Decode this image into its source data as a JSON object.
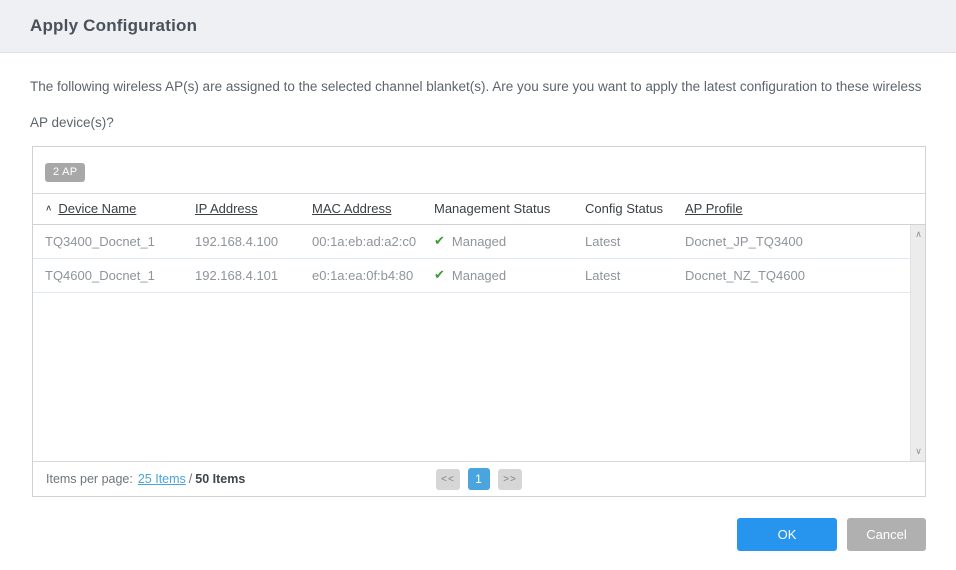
{
  "dialog": {
    "title": "Apply Configuration",
    "description": "The following wireless AP(s) are assigned to the selected channel blanket(s). Are you sure you want to apply the latest configuration to these wireless AP device(s)?"
  },
  "table": {
    "count_badge": "2 AP",
    "columns": [
      {
        "label": "Device Name",
        "sortable": true,
        "sorted": "asc"
      },
      {
        "label": "IP Address",
        "sortable": true
      },
      {
        "label": "MAC Address",
        "sortable": true
      },
      {
        "label": "Management Status",
        "sortable": false
      },
      {
        "label": "Config Status",
        "sortable": false
      },
      {
        "label": "AP Profile",
        "sortable": true
      }
    ],
    "rows": [
      {
        "device_name": "TQ3400_Docnet_1",
        "ip_address": "192.168.4.100",
        "mac_address": "00:1a:eb:ad:a2:c0",
        "management_status": "Managed",
        "config_status": "Latest",
        "ap_profile": "Docnet_JP_TQ3400"
      },
      {
        "device_name": "TQ4600_Docnet_1",
        "ip_address": "192.168.4.101",
        "mac_address": "e0:1a:ea:0f:b4:80",
        "management_status": "Managed",
        "config_status": "Latest",
        "ap_profile": "Docnet_NZ_TQ4600"
      }
    ]
  },
  "icons": {
    "sort_asc": "∧",
    "managed_check": "✔",
    "scroll_up": "∧",
    "scroll_down": "∨"
  },
  "pagination": {
    "items_per_page_label": "Items per page:",
    "per_page_link": "25 Items",
    "separator": "/",
    "total_items": "50 Items",
    "prev_label": "<<",
    "current_page": "1",
    "next_label": ">>"
  },
  "actions": {
    "ok_label": "OK",
    "cancel_label": "Cancel"
  },
  "colors": {
    "titlebar_bg": "#eef0f3",
    "accent_blue": "#2795ee",
    "pager_active_blue": "#4aa5de",
    "link_blue": "#4aa3da",
    "managed_green": "#3d9b35",
    "badge_gray": "#a8a8a8",
    "cancel_gray": "#b0b0b0"
  }
}
